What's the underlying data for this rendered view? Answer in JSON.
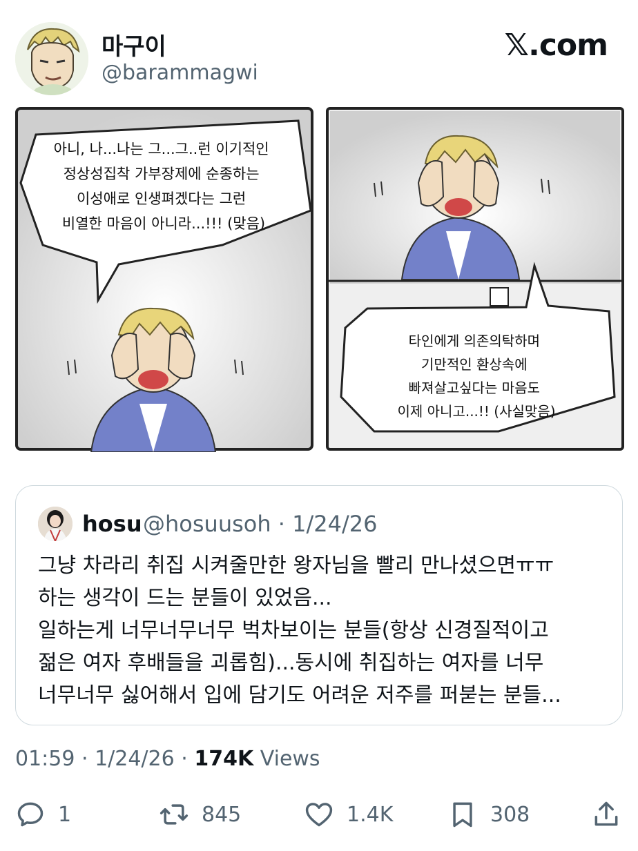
{
  "author": {
    "display_name": "마구이",
    "handle": "@barammagwi"
  },
  "brand": "𝕏.com",
  "comic": {
    "left_bubble": "아니, 나...나는 그...그..런 이기적인\n정상성집착 가부장제에 순종하는\n이성애로 인생펴겠다는 그런\n비열한 마음이 아니라...!!! (맞음)",
    "right_bubble": "타인에게 의존의탁하며\n기만적인 환상속에\n빠져살고싶다는 마음도\n이제 아니고...!! (사실맞음)"
  },
  "quote": {
    "name": "hosu",
    "meta": "@hosuusoh · 1/24/26",
    "body": "그냥 차라리 취집 시켜줄만한 왕자님을 빨리 만나셨으면ㅠㅠ\n하는 생각이 드는 분들이 있었음...\n일하는게 너무너무너무 벅차보이는 분들(항상 신경질적이고\n젊은 여자 후배들을 괴롭힘)...동시에 취집하는 여자를 너무\n너무너무 싫어해서 입에 담기도 어려운 저주를 퍼붇는 분들..."
  },
  "meta": {
    "time": "01:59 · 1/24/26 · ",
    "views_count": "174K",
    "views_label": " Views"
  },
  "actions": {
    "replies": "1",
    "reposts": "845",
    "likes": "1.4K",
    "bookmarks": "308"
  },
  "icons": [
    "reply-icon",
    "repost-icon",
    "like-icon",
    "bookmark-icon",
    "share-icon"
  ],
  "colors": {
    "secondary_text": "#536471",
    "border": "#cfd9de",
    "shirt": "#6e7fc6"
  }
}
